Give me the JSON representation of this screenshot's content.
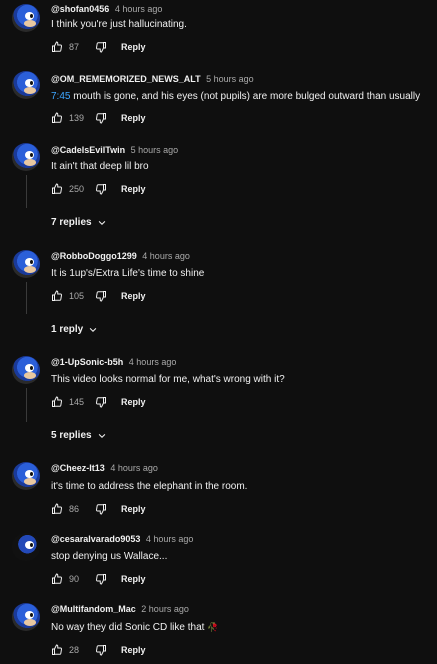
{
  "comments": [
    {
      "author": "@shofan0456",
      "time": "4 hours ago",
      "text": "I think you're just hallucinating.",
      "likes": "87",
      "reply": "Reply"
    },
    {
      "author": "@OM_REMEMORIZED_NEWS_ALT",
      "time": "5 hours ago",
      "timestamp": "7:45",
      "text": " mouth is gone, and his eyes (not pupils) are more bulged outward than usually",
      "likes": "139",
      "reply": "Reply"
    },
    {
      "author": "@CadelsEvilTwin",
      "time": "5 hours ago",
      "text": "It ain't that deep lil bro",
      "likes": "250",
      "reply": "Reply",
      "replies": "7 replies"
    },
    {
      "author": "@RobboDoggo1299",
      "time": "4 hours ago",
      "text": "It is 1up's/Extra Life's time to shine",
      "likes": "105",
      "reply": "Reply",
      "replies": "1 reply"
    },
    {
      "author": "@1-UpSonic-b5h",
      "time": "4 hours ago",
      "text": "This video looks normal for me, what's wrong with it?",
      "likes": "145",
      "reply": "Reply",
      "replies": "5 replies"
    },
    {
      "author": "@Cheez-It13",
      "time": "4 hours ago",
      "text": "it's time to address the elephant in the room.",
      "likes": "86",
      "reply": "Reply"
    },
    {
      "author": "@cesaralvarado9053",
      "time": "4 hours ago",
      "text": "stop denying us Wallace...",
      "likes": "90",
      "reply": "Reply"
    },
    {
      "author": "@Multifandom_Mac",
      "time": "2 hours ago",
      "text": "No way they did Sonic CD like that ",
      "emoji": "🥀",
      "likes": "28",
      "reply": "Reply"
    }
  ],
  "icons": {
    "like": "thumbs-up-icon",
    "dislike": "thumbs-down-icon",
    "expand": "chevron-down-icon"
  },
  "colors": {
    "background": "#0f0f0f",
    "text": "#f1f1f1",
    "muted": "#aaaaaa",
    "link": "#3ea6ff"
  }
}
